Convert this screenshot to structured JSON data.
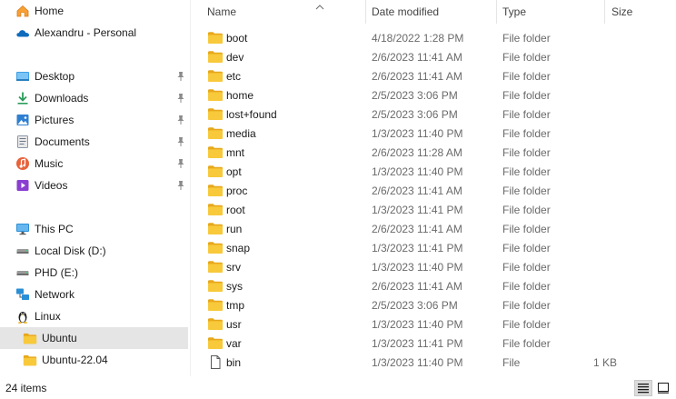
{
  "nav": {
    "items": [
      {
        "label": "Home",
        "icon": "home-icon"
      },
      {
        "label": "Alexandru - Personal",
        "icon": "onedrive-cloud-icon"
      },
      {
        "label": "Desktop",
        "icon": "desktop-icon",
        "pinned": true
      },
      {
        "label": "Downloads",
        "icon": "downloads-icon",
        "pinned": true
      },
      {
        "label": "Pictures",
        "icon": "pictures-icon",
        "pinned": true
      },
      {
        "label": "Documents",
        "icon": "documents-icon",
        "pinned": true
      },
      {
        "label": "Music",
        "icon": "music-icon",
        "pinned": true
      },
      {
        "label": "Videos",
        "icon": "videos-icon",
        "pinned": true
      },
      {
        "label": "This PC",
        "icon": "this-pc-icon"
      },
      {
        "label": "Local Disk (D:)",
        "icon": "drive-icon"
      },
      {
        "label": "PHD (E:)",
        "icon": "drive-icon"
      },
      {
        "label": "Network",
        "icon": "network-icon"
      },
      {
        "label": "Linux",
        "icon": "linux-penguin-icon"
      },
      {
        "label": "Ubuntu",
        "icon": "folder-icon",
        "selected": true
      },
      {
        "label": "Ubuntu-22.04",
        "icon": "folder-icon"
      }
    ]
  },
  "columns": {
    "name": "Name",
    "date_modified": "Date modified",
    "type": "Type",
    "size": "Size"
  },
  "files": [
    {
      "name": "boot",
      "date": "4/18/2022 1:28 PM",
      "type": "File folder",
      "size": "",
      "icon": "folder-icon"
    },
    {
      "name": "dev",
      "date": "2/6/2023 11:41 AM",
      "type": "File folder",
      "size": "",
      "icon": "folder-icon"
    },
    {
      "name": "etc",
      "date": "2/6/2023 11:41 AM",
      "type": "File folder",
      "size": "",
      "icon": "folder-icon"
    },
    {
      "name": "home",
      "date": "2/5/2023 3:06 PM",
      "type": "File folder",
      "size": "",
      "icon": "folder-icon"
    },
    {
      "name": "lost+found",
      "date": "2/5/2023 3:06 PM",
      "type": "File folder",
      "size": "",
      "icon": "folder-icon"
    },
    {
      "name": "media",
      "date": "1/3/2023 11:40 PM",
      "type": "File folder",
      "size": "",
      "icon": "folder-icon"
    },
    {
      "name": "mnt",
      "date": "2/6/2023 11:28 AM",
      "type": "File folder",
      "size": "",
      "icon": "folder-icon"
    },
    {
      "name": "opt",
      "date": "1/3/2023 11:40 PM",
      "type": "File folder",
      "size": "",
      "icon": "folder-icon"
    },
    {
      "name": "proc",
      "date": "2/6/2023 11:41 AM",
      "type": "File folder",
      "size": "",
      "icon": "folder-icon"
    },
    {
      "name": "root",
      "date": "1/3/2023 11:41 PM",
      "type": "File folder",
      "size": "",
      "icon": "folder-icon"
    },
    {
      "name": "run",
      "date": "2/6/2023 11:41 AM",
      "type": "File folder",
      "size": "",
      "icon": "folder-icon"
    },
    {
      "name": "snap",
      "date": "1/3/2023 11:41 PM",
      "type": "File folder",
      "size": "",
      "icon": "folder-icon"
    },
    {
      "name": "srv",
      "date": "1/3/2023 11:40 PM",
      "type": "File folder",
      "size": "",
      "icon": "folder-icon"
    },
    {
      "name": "sys",
      "date": "2/6/2023 11:41 AM",
      "type": "File folder",
      "size": "",
      "icon": "folder-icon"
    },
    {
      "name": "tmp",
      "date": "2/5/2023 3:06 PM",
      "type": "File folder",
      "size": "",
      "icon": "folder-icon"
    },
    {
      "name": "usr",
      "date": "1/3/2023 11:40 PM",
      "type": "File folder",
      "size": "",
      "icon": "folder-icon"
    },
    {
      "name": "var",
      "date": "1/3/2023 11:41 PM",
      "type": "File folder",
      "size": "",
      "icon": "folder-icon"
    },
    {
      "name": "bin",
      "date": "1/3/2023 11:40 PM",
      "type": "File",
      "size": "1 KB",
      "icon": "file-icon"
    }
  ],
  "status": {
    "item_count": "24 items"
  },
  "colors": {
    "folder_yellow": "#f8c93a",
    "folder_dark": "#e7a81c",
    "selected_bg": "#e5e5e5",
    "accent_blue": "#0f6cbd"
  }
}
